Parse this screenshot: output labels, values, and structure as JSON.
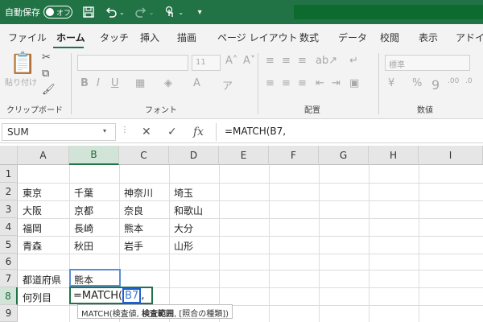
{
  "titlebar": {
    "autosave_label": "自動保存",
    "autosave_state": "オフ"
  },
  "menu": [
    "ファイル",
    "ホーム",
    "タッチ",
    "挿入",
    "描画",
    "ページ レイアウト",
    "数式",
    "データ",
    "校閲",
    "表示",
    "アドイン"
  ],
  "ribbon": {
    "clipboard_label": "クリップボード",
    "paste_label": "貼り付け",
    "font_label": "フォント",
    "font_size": "11",
    "align_label": "配置",
    "number_label": "数値",
    "number_format": "標準"
  },
  "formula_bar": {
    "name_box": "SUM",
    "formula": "=MATCH(B7,"
  },
  "columns": [
    "A",
    "B",
    "C",
    "D",
    "E",
    "F",
    "G",
    "H",
    "I"
  ],
  "rows": [
    "1",
    "2",
    "3",
    "4",
    "5",
    "6",
    "7",
    "8",
    "9"
  ],
  "cells": {
    "r2": [
      "東京",
      "千葉",
      "神奈川",
      "埼玉"
    ],
    "r3": [
      "大阪",
      "京都",
      "奈良",
      "和歌山"
    ],
    "r4": [
      "福岡",
      "長崎",
      "熊本",
      "大分"
    ],
    "r5": [
      "青森",
      "秋田",
      "岩手",
      "山形"
    ],
    "a7": "都道府県",
    "b7": "熊本",
    "a8": "何列目",
    "b8_prefix": "=MATCH(",
    "b8_ref": "B7",
    "b8_suffix": ","
  },
  "tooltip": {
    "fn": "MATCH(",
    "arg1": "検査値",
    "sep1": ", ",
    "arg2": "検査範囲",
    "sep2": ", ",
    "arg3": "[照合の種類]",
    "end": ")"
  },
  "colors": {
    "excel_green": "#217346",
    "ref_blue": "#1f5fd1"
  }
}
